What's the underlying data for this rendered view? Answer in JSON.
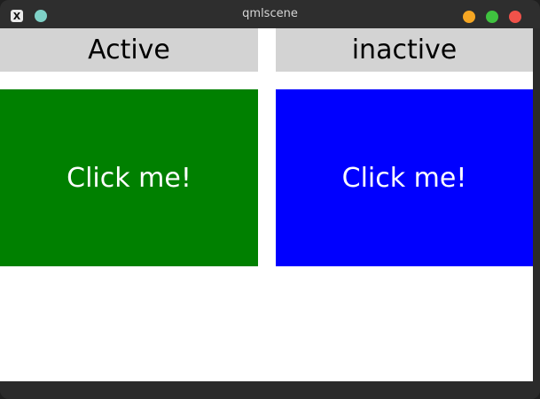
{
  "window": {
    "title": "qmlscene",
    "app_icon_glyph": "X",
    "controls": [
      "minimize-button",
      "maximize-button",
      "close-button"
    ]
  },
  "panels": {
    "left": {
      "label": "Active",
      "button_text": "Click me!",
      "color": "#008000"
    },
    "right": {
      "label": "inactive",
      "button_text": "Click me!",
      "color": "#0000ff"
    }
  },
  "colors": {
    "label_background": "#d3d3d3",
    "content_background": "#ffffff",
    "titlebar": "#2e2e2e",
    "minimize": "#f5a623",
    "maximize": "#3fc23f",
    "close": "#f0524a"
  }
}
